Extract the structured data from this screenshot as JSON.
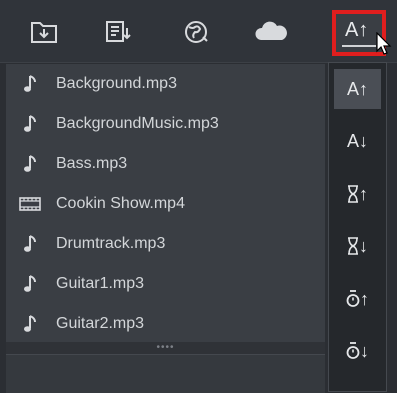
{
  "toolbar": {
    "buttons": [
      {
        "icon": "import-folder-icon"
      },
      {
        "icon": "export-list-icon"
      },
      {
        "icon": "globe-icon"
      },
      {
        "icon": "cloud-icon"
      }
    ],
    "sort_button": {
      "label": "A↑",
      "icon": "sort-name-ascending-icon"
    }
  },
  "files": [
    {
      "name": "Background.mp3",
      "icon": "music-note-icon"
    },
    {
      "name": "BackgroundMusic.mp3",
      "icon": "music-note-icon"
    },
    {
      "name": "Bass.mp3",
      "icon": "music-note-icon"
    },
    {
      "name": "Cookin Show.mp4",
      "icon": "film-icon"
    },
    {
      "name": "Drumtrack.mp3",
      "icon": "music-note-icon"
    },
    {
      "name": "Guitar1.mp3",
      "icon": "music-note-icon"
    },
    {
      "name": "Guitar2.mp3",
      "icon": "music-note-icon"
    }
  ],
  "divider": {
    "grip": "••••"
  },
  "sort_menu": [
    {
      "label": "A↑",
      "icon": "sort-name-ascending-icon",
      "selected": true
    },
    {
      "label": "A↓",
      "icon": "sort-name-descending-icon",
      "selected": false
    },
    {
      "label": "↑",
      "icon": "sort-duration-ascending-icon",
      "selected": false
    },
    {
      "label": "↓",
      "icon": "sort-duration-descending-icon",
      "selected": false
    },
    {
      "label": "↑",
      "icon": "sort-date-ascending-icon",
      "selected": false
    },
    {
      "label": "↓",
      "icon": "sort-date-descending-icon",
      "selected": false
    }
  ],
  "colors": {
    "highlight_border": "#e01e1e",
    "list_background": "#3a3e44",
    "menu_background": "#25282c"
  }
}
